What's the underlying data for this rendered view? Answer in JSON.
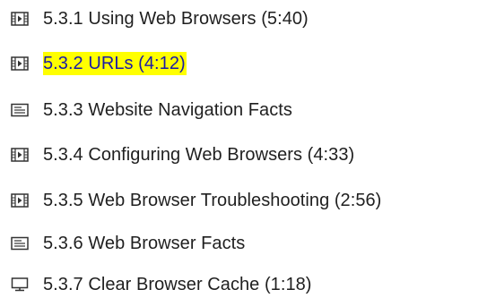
{
  "course_items": [
    {
      "label": "5.3.1 Using Web Browsers (5:40)",
      "icon": "video-icon"
    },
    {
      "label": "5.3.2 URLs (4:12)",
      "icon": "video-icon",
      "highlighted": true,
      "highlight_color": "#ffff00",
      "text_color": "#1a1aa8"
    },
    {
      "label": "5.3.3 Website Navigation Facts",
      "icon": "document-icon"
    },
    {
      "label": "5.3.4 Configuring Web Browsers (4:33)",
      "icon": "video-icon"
    },
    {
      "label": "5.3.5 Web Browser Troubleshooting (2:56)",
      "icon": "video-icon"
    },
    {
      "label": "5.3.6 Web Browser Facts",
      "icon": "document-icon"
    },
    {
      "label": "5.3.7 Clear Browser Cache (1:18)",
      "icon": "computer-icon"
    }
  ]
}
